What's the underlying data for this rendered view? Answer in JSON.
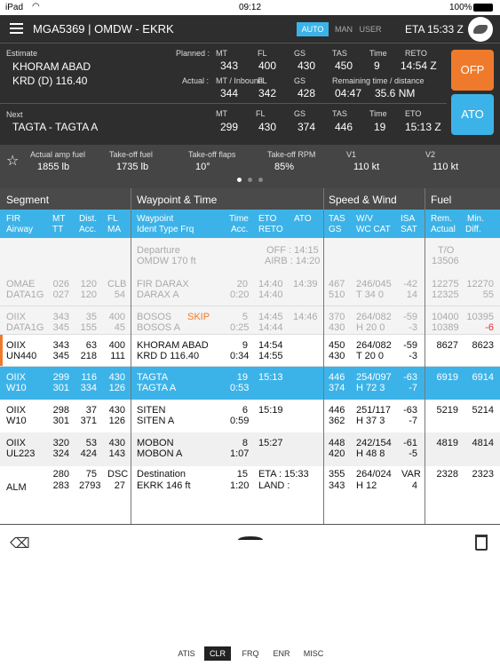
{
  "status": {
    "device": "iPad",
    "time": "09:12",
    "battery": "100%"
  },
  "header": {
    "flight": "MGA5369  |  OMDW - EKRK",
    "modes": [
      "AUTO",
      "MAN",
      "USER"
    ],
    "eta": "ETA  15:33 Z"
  },
  "estimate": {
    "label": "Estimate",
    "name": "KHORAM ABAD",
    "nav": "KRD (D) 116.40"
  },
  "planned": {
    "label": "Planned :",
    "mt_h": "MT",
    "fl_h": "FL",
    "gs_h": "GS",
    "tas_h": "TAS",
    "time_h": "Time",
    "reto_h": "RETO",
    "mt": "343",
    "fl": "400",
    "gs": "430",
    "tas": "450",
    "time": "9",
    "reto": "14:54 Z"
  },
  "actual": {
    "label": "Actual :",
    "mt_h": "MT / Inbound",
    "fl_h": "FL",
    "gs_h": "GS",
    "rem_h": "Remaining time / distance",
    "mt": "344",
    "fl": "342",
    "gs": "428",
    "rem_time": "04:47",
    "rem_dist": "35.6 NM"
  },
  "next": {
    "label": "Next",
    "name": "TAGTA - TAGTA  A",
    "mt_h": "MT",
    "fl_h": "FL",
    "gs_h": "GS",
    "tas_h": "TAS",
    "time_h": "Time",
    "eto_h": "ETO",
    "mt": "299",
    "fl": "430",
    "gs": "374",
    "tas": "446",
    "time": "19",
    "eto": "15:13 Z"
  },
  "buttons": {
    "ofp": "OFP",
    "ato": "ATO"
  },
  "takeoff": {
    "items": [
      {
        "l": "Actual amp fuel",
        "v": "1855 lb"
      },
      {
        "l": "Take-off fuel",
        "v": "1735 lb"
      },
      {
        "l": "Take-off flaps",
        "v": "10°"
      },
      {
        "l": "Take-off RPM",
        "v": "85%"
      },
      {
        "l": "V1",
        "v": "110 kt"
      },
      {
        "l": "V2",
        "v": "110 kt"
      }
    ]
  },
  "sections": [
    "Segment",
    "Waypoint & Time",
    "Speed & Wind",
    "Fuel"
  ],
  "cols": {
    "fir": "FIR",
    "airway": "Airway",
    "mt": "MT",
    "tt": "TT",
    "dist": "Dist.",
    "acc": "Acc.",
    "fl": "FL",
    "ma": "MA",
    "wp": "Waypoint",
    "ident": "Ident Type Frq",
    "time": "Time",
    "tacc": "Acc.",
    "eto": "ETO",
    "reto": "RETO",
    "ato": "ATO",
    "tas": "TAS",
    "gs": "GS",
    "wv": "W/V",
    "wccat": "WC CAT",
    "isa": "ISA",
    "sat": "SAT",
    "rem": "Rem.",
    "act": "Actual",
    "min": "Min.",
    "diff": "Diff."
  },
  "departure": {
    "wp": "Departure",
    "ident": "OMDW  170 ft",
    "off": "OFF : 14:15",
    "airb": "AIRB : 14:20",
    "to": "T/O",
    "fuel": "13506"
  },
  "rows": [
    {
      "a": [
        "OMAE",
        "DATA1G"
      ],
      "b": [
        "026",
        "027"
      ],
      "c": [
        "120",
        "120"
      ],
      "d": [
        "CLB",
        "54"
      ],
      "e": [
        "FIR DARAX",
        "DARAX  A"
      ],
      "f": [
        "20",
        "0:20"
      ],
      "g": [
        "14:40",
        "14:40"
      ],
      "h": [
        "14:39",
        ""
      ],
      "i": [
        "467",
        "510"
      ],
      "j": [
        "246/045",
        "T 34  0"
      ],
      "k": [
        "-42",
        "14"
      ],
      "l": [
        "12275",
        "12325"
      ],
      "m": [
        "12270",
        "55"
      ],
      "skip": ""
    },
    {
      "a": [
        "OIIX",
        "DATA1G"
      ],
      "b": [
        "343",
        "345"
      ],
      "c": [
        "35",
        "155"
      ],
      "d": [
        "400",
        "45"
      ],
      "e": [
        "BOSOS",
        "BOSOS  A"
      ],
      "f": [
        "5",
        "0:25"
      ],
      "g": [
        "14:45",
        "14:44"
      ],
      "h": [
        "14:46",
        ""
      ],
      "i": [
        "370",
        "430"
      ],
      "j": [
        "264/082",
        "H 20  0"
      ],
      "k": [
        "-59",
        "-3"
      ],
      "l": [
        "10400",
        "10389"
      ],
      "m": [
        "10395",
        "-6"
      ],
      "skip": "SKIP"
    },
    {
      "a": [
        "OIIX",
        "UN440"
      ],
      "b": [
        "343",
        "345"
      ],
      "c": [
        "63",
        "218"
      ],
      "d": [
        "400",
        "111"
      ],
      "e": [
        "KHORAM ABAD",
        "KRD  D  116.40"
      ],
      "f": [
        "9",
        "0:34"
      ],
      "g": [
        "14:54",
        "14:55"
      ],
      "h": [
        "",
        ""
      ],
      "i": [
        "450",
        "430"
      ],
      "j": [
        "264/082",
        "T 20  0"
      ],
      "k": [
        "-59",
        "-3"
      ],
      "l": [
        "8627",
        ""
      ],
      "m": [
        "8623",
        ""
      ],
      "skip": ""
    },
    {
      "a": [
        "OIIX",
        "W10"
      ],
      "b": [
        "299",
        "301"
      ],
      "c": [
        "116",
        "334"
      ],
      "d": [
        "430",
        "126"
      ],
      "e": [
        "TAGTA",
        "TAGTA  A"
      ],
      "f": [
        "19",
        "0:53"
      ],
      "g": [
        "15:13",
        ""
      ],
      "h": [
        "",
        ""
      ],
      "i": [
        "446",
        "374"
      ],
      "j": [
        "254/097",
        "H 72  3"
      ],
      "k": [
        "-63",
        "-7"
      ],
      "l": [
        "6919",
        ""
      ],
      "m": [
        "6914",
        ""
      ],
      "skip": ""
    },
    {
      "a": [
        "OIIX",
        "W10"
      ],
      "b": [
        "298",
        "301"
      ],
      "c": [
        "37",
        "371"
      ],
      "d": [
        "430",
        "126"
      ],
      "e": [
        "SITEN",
        "SITEN  A"
      ],
      "f": [
        "6",
        "0:59"
      ],
      "g": [
        "15:19",
        ""
      ],
      "h": [
        "",
        ""
      ],
      "i": [
        "446",
        "362"
      ],
      "j": [
        "251/117",
        "H 37  3"
      ],
      "k": [
        "-63",
        "-7"
      ],
      "l": [
        "5219",
        ""
      ],
      "m": [
        "5214",
        ""
      ],
      "skip": ""
    },
    {
      "a": [
        "OIIX",
        "UL223"
      ],
      "b": [
        "320",
        "324"
      ],
      "c": [
        "53",
        "424"
      ],
      "d": [
        "430",
        "143"
      ],
      "e": [
        "MOBON",
        "MOBON  A"
      ],
      "f": [
        "8",
        "1:07"
      ],
      "g": [
        "15:27",
        ""
      ],
      "h": [
        "",
        ""
      ],
      "i": [
        "448",
        "420"
      ],
      "j": [
        "242/154",
        "H 48  8"
      ],
      "k": [
        "-61",
        "-5"
      ],
      "l": [
        "4819",
        ""
      ],
      "m": [
        "4814",
        ""
      ],
      "skip": ""
    },
    {
      "a": [
        "",
        "ALM"
      ],
      "b": [
        "280",
        "283"
      ],
      "c": [
        "75",
        "2793"
      ],
      "d": [
        "DSC",
        "27"
      ],
      "e": [
        "Destination",
        "EKRK  146 ft"
      ],
      "f": [
        "15",
        "1:20"
      ],
      "g": [
        "ETA : 15:33",
        "LAND :"
      ],
      "h": [
        "",
        ""
      ],
      "i": [
        "355",
        "343"
      ],
      "j": [
        "264/024",
        "H 12"
      ],
      "k": [
        "VAR",
        "4"
      ],
      "l": [
        "2328",
        ""
      ],
      "m": [
        "2323",
        ""
      ],
      "skip": ""
    }
  ],
  "tabs": [
    "ATIS",
    "CLR",
    "FRQ",
    "ENR",
    "MISC"
  ]
}
